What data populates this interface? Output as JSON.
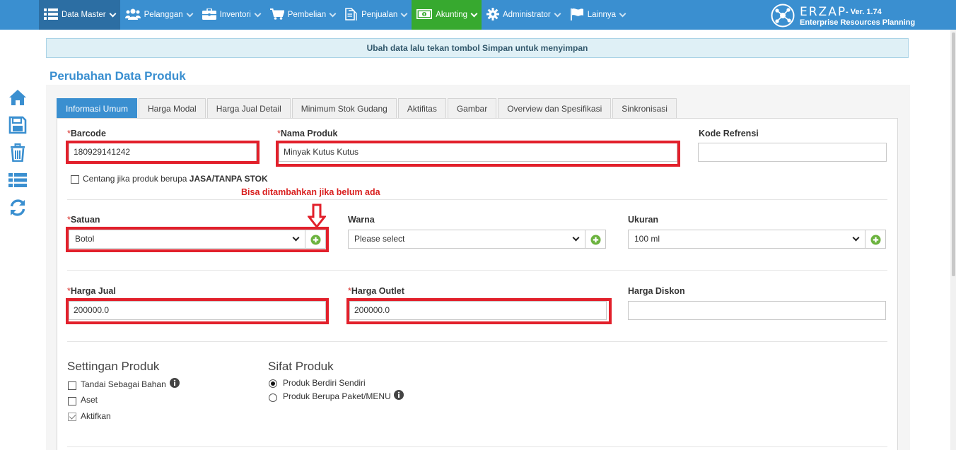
{
  "nav": {
    "items": [
      {
        "label": "Data Master",
        "icon": "list-icon"
      },
      {
        "label": "Pelanggan",
        "icon": "users-icon"
      },
      {
        "label": "Inventori",
        "icon": "briefcase-icon"
      },
      {
        "label": "Pembelian",
        "icon": "cart-icon"
      },
      {
        "label": "Penjualan",
        "icon": "document-icon"
      },
      {
        "label": "Akunting",
        "icon": "money-icon"
      },
      {
        "label": "Administrator",
        "icon": "gear-icon"
      },
      {
        "label": "Lainnya",
        "icon": "flag-icon"
      }
    ]
  },
  "brand": {
    "logo_text": "ERZAP",
    "version": "- Ver. 1.74",
    "tagline": "Enterprise Resources Planning"
  },
  "notice": "Ubah data lalu tekan tombol Simpan untuk menyimpan",
  "page_title": "Perubahan Data Produk",
  "sidebar_icons": [
    "home-icon",
    "save-icon",
    "trash-icon",
    "list-icon",
    "refresh-icon"
  ],
  "tabs": [
    {
      "label": "Informasi Umum",
      "active": true
    },
    {
      "label": "Harga Modal"
    },
    {
      "label": "Harga Jual Detail"
    },
    {
      "label": "Minimum Stok Gudang"
    },
    {
      "label": "Aktifitas"
    },
    {
      "label": "Gambar"
    },
    {
      "label": "Overview dan Spesifikasi"
    },
    {
      "label": "Sinkronisasi"
    }
  ],
  "form": {
    "required_mark": "*",
    "barcode": {
      "label": "Barcode",
      "value": "180929141242"
    },
    "nama_produk": {
      "label": "Nama Produk",
      "value": "Minyak Kutus Kutus"
    },
    "kode_refrensi": {
      "label": "Kode Refrensi",
      "value": ""
    },
    "jasa_checkbox": {
      "prefix": "Centang jika produk berupa ",
      "bold": "JASA/TANPA STOK"
    },
    "annotation": "Bisa ditambahkan jika belum ada",
    "satuan": {
      "label": "Satuan",
      "value": "Botol"
    },
    "warna": {
      "label": "Warna",
      "value": "Please select"
    },
    "ukuran": {
      "label": "Ukuran",
      "value": "100 ml"
    },
    "harga_jual": {
      "label": "Harga Jual",
      "value": "200000.0"
    },
    "harga_outlet": {
      "label": "Harga Outlet",
      "value": "200000.0"
    },
    "harga_diskon": {
      "label": "Harga Diskon",
      "value": ""
    }
  },
  "settingan": {
    "title": "Settingan Produk",
    "options": [
      {
        "label": "Tandai Sebagai Bahan",
        "checked": false
      },
      {
        "label": "Aset",
        "checked": false
      },
      {
        "label": "Aktifkan",
        "checked": true
      }
    ]
  },
  "sifat": {
    "title": "Sifat Produk",
    "options": [
      {
        "label": "Produk Berdiri Sendiri",
        "selected": true
      },
      {
        "label": "Produk Berupa Paket/MENU",
        "selected": false
      }
    ]
  },
  "colors": {
    "primary": "#3a8fd0",
    "active_green": "#37a92f",
    "highlight_red": "#e2202b",
    "add_green": "#6cb33f"
  }
}
